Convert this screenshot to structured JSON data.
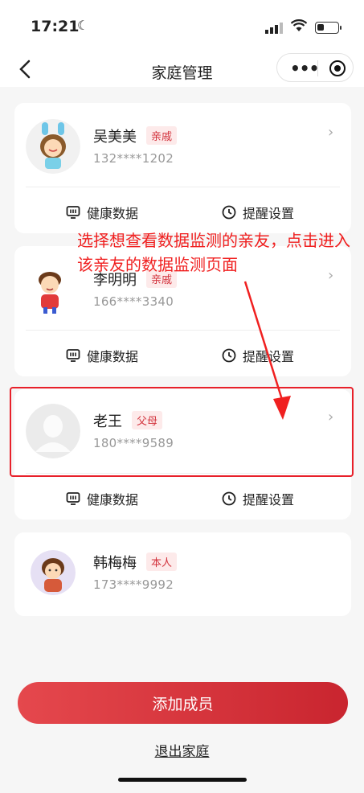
{
  "status_bar": {
    "time": "17:21",
    "battery_level": 0.25
  },
  "nav": {
    "title": "家庭管理",
    "more_icon": "more-dots-icon",
    "close_icon": "target-icon"
  },
  "members": [
    {
      "name": "吴美美",
      "tag": "亲戚",
      "phone": "132****1202",
      "avatar": "bunny-girl-avatar"
    },
    {
      "name": "李明明",
      "tag": "亲戚",
      "phone": "166****3340",
      "avatar": "boy-avatar"
    },
    {
      "name": "老王",
      "tag": "父母",
      "phone": "180****9589",
      "avatar": "default-avatar"
    },
    {
      "name": "韩梅梅",
      "tag": "本人",
      "phone": "173****9992",
      "avatar": "girl-avatar"
    }
  ],
  "actions": {
    "health": "健康数据",
    "reminder": "提醒设置"
  },
  "annotation": "选择想查看数据监测的亲友，点击进入该亲友的数据监测页面",
  "buttons": {
    "add_member": "添加成员",
    "quit_family": "退出家庭"
  },
  "colors": {
    "accent": "#d2323c",
    "annotation": "#f02020"
  }
}
